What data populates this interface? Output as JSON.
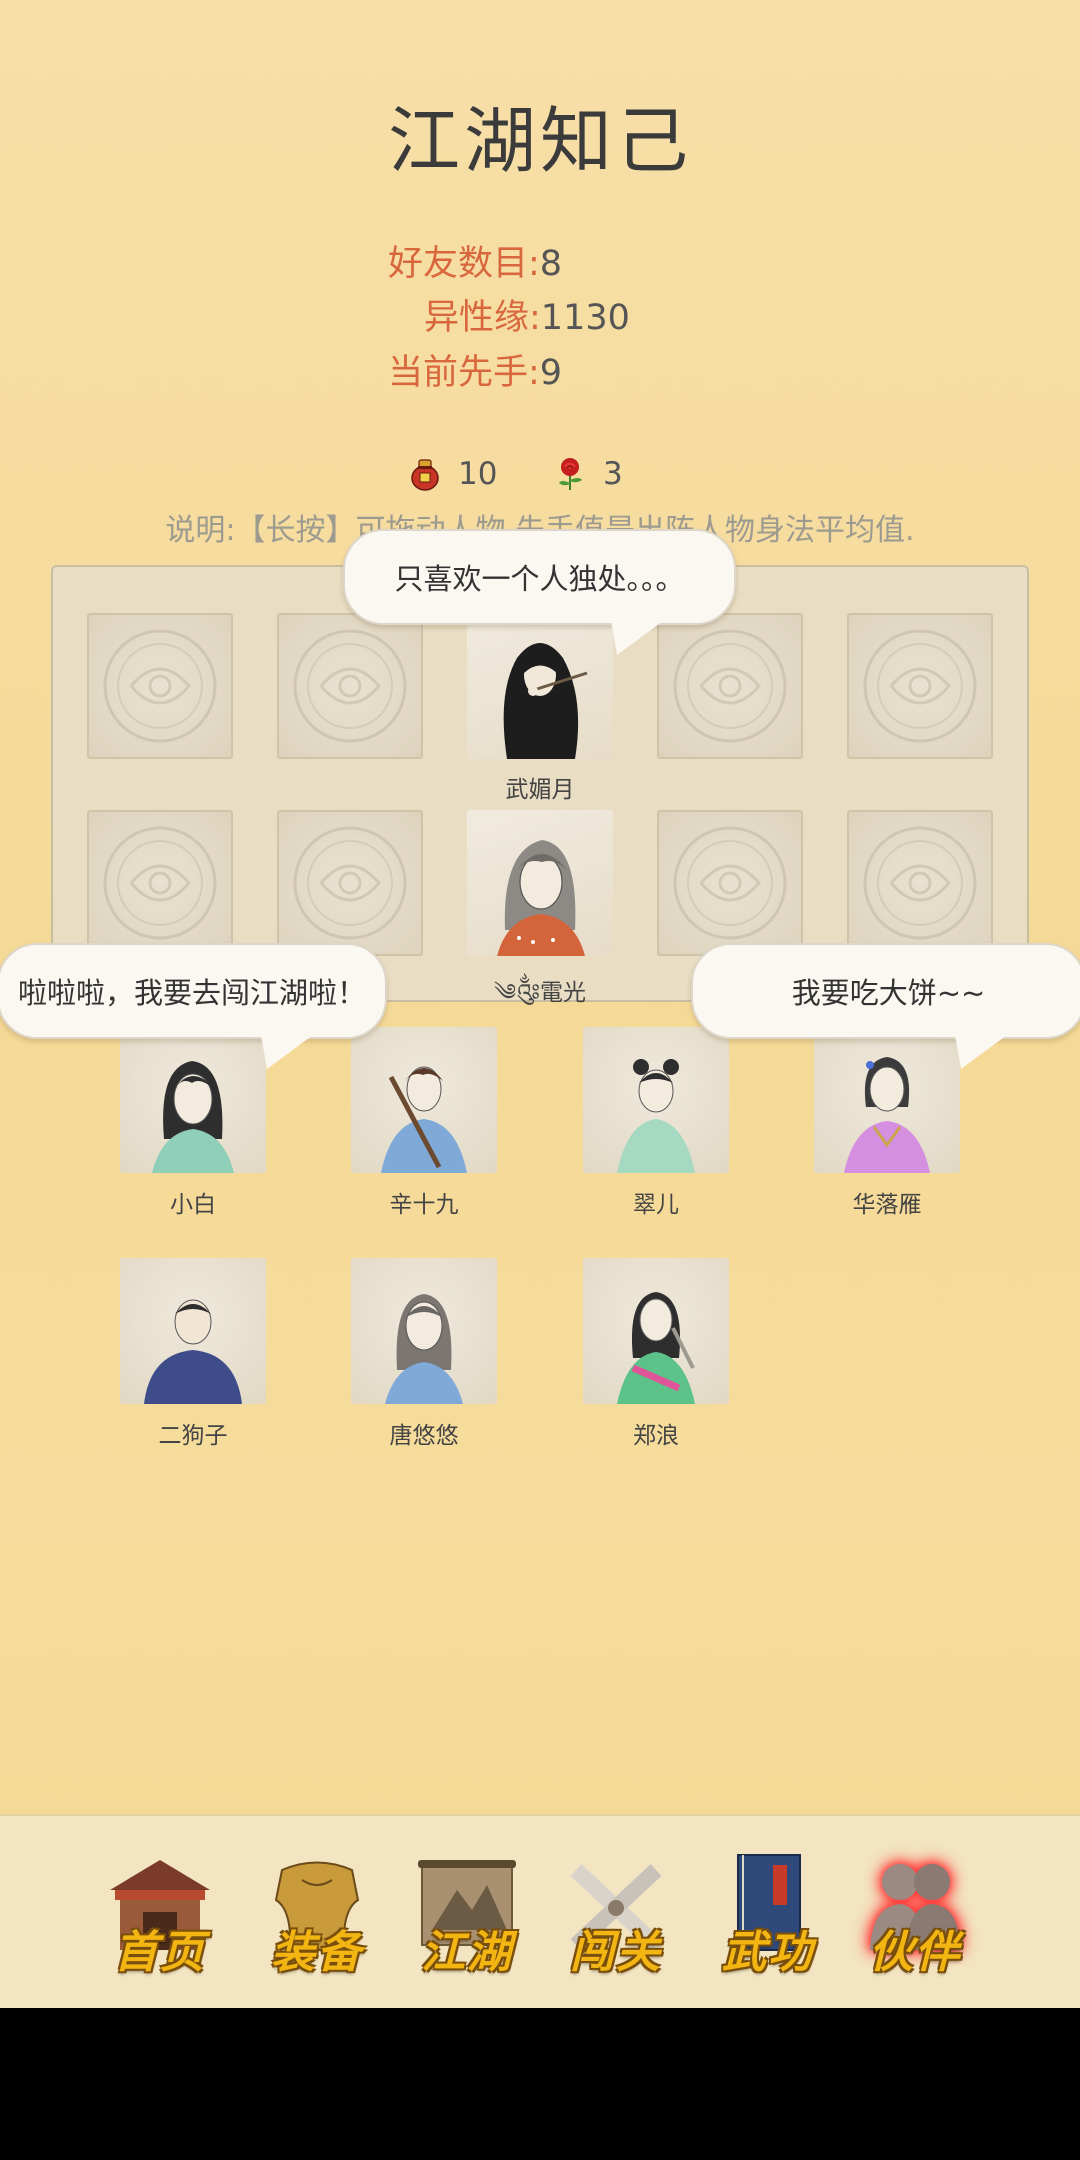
{
  "title": "江湖知己",
  "stats": {
    "friends_label": "好友数目:",
    "friends_value": "8",
    "charm_label": "异性缘:",
    "charm_value": "1130",
    "initiative_label": "当前先手:",
    "initiative_value": "9"
  },
  "items": {
    "wine_count": "10",
    "rose_count": "3"
  },
  "note": "说明:【长按】可拖动人物,先手值是出阵人物身法平均值.",
  "board": {
    "slot1_name": "武媚月",
    "slot2_name": "༄༂電光"
  },
  "bubbles": {
    "b1": "只喜欢一个人独处。。。",
    "b2": "啦啦啦，我要去闯江湖啦！",
    "b3": "我要吃大饼~~"
  },
  "friends": [
    {
      "name": "小白"
    },
    {
      "name": "辛十九"
    },
    {
      "name": "翠儿"
    },
    {
      "name": "华落雁"
    },
    {
      "name": "二狗子"
    },
    {
      "name": "唐悠悠"
    },
    {
      "name": "郑浪"
    }
  ],
  "nav": {
    "home": "首页",
    "equip": "装备",
    "jianghu": "江湖",
    "stage": "闯关",
    "martial": "武功",
    "partner": "伙伴"
  },
  "colors": {
    "label_orange": "#d9673e",
    "nav_gold": "#f2b512",
    "active_glow": "#ff3a3a"
  }
}
